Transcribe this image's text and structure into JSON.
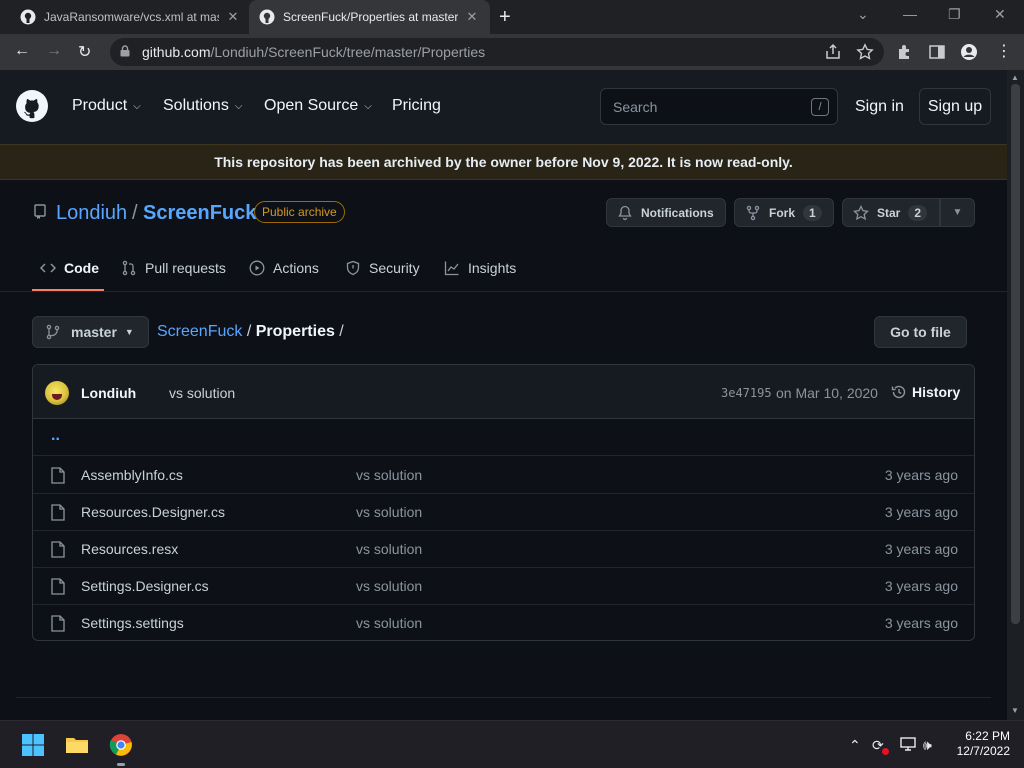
{
  "browser": {
    "tabs": [
      {
        "title": "JavaRansomware/vcs.xml at mast",
        "active": false
      },
      {
        "title": "ScreenFuck/Properties at master",
        "active": true
      }
    ],
    "url_domain": "github.com",
    "url_path": "/Londiuh/ScreenFuck/tree/master/Properties"
  },
  "header": {
    "menu": [
      {
        "label": "Product",
        "dropdown": true
      },
      {
        "label": "Solutions",
        "dropdown": true
      },
      {
        "label": "Open Source",
        "dropdown": true
      },
      {
        "label": "Pricing",
        "dropdown": false
      }
    ],
    "search_placeholder": "Search",
    "search_key": "/",
    "sign_in": "Sign in",
    "sign_up": "Sign up"
  },
  "banner": "This repository has been archived by the owner before Nov 9, 2022. It is now read-only.",
  "repo": {
    "owner": "Londiuh",
    "separator": "/",
    "name": "ScreenFuck",
    "badge": "Public archive",
    "notifications": "Notifications",
    "fork_label": "Fork",
    "fork_count": "1",
    "star_label": "Star",
    "star_count": "2",
    "tabs": [
      "Code",
      "Pull requests",
      "Actions",
      "Security",
      "Insights"
    ]
  },
  "path": {
    "branch": "master",
    "root": "ScreenFuck",
    "sep1": " / ",
    "current": "Properties",
    "sep2": " /",
    "goto_file": "Go to file"
  },
  "commit": {
    "author": "Londiuh",
    "message": "vs solution",
    "sha": "3e47195",
    "date": "on Mar 10, 2020",
    "history": "History"
  },
  "files": {
    "up": "..",
    "rows": [
      {
        "name": "AssemblyInfo.cs",
        "message": "vs solution",
        "age": "3 years ago"
      },
      {
        "name": "Resources.Designer.cs",
        "message": "vs solution",
        "age": "3 years ago"
      },
      {
        "name": "Resources.resx",
        "message": "vs solution",
        "age": "3 years ago"
      },
      {
        "name": "Settings.Designer.cs",
        "message": "vs solution",
        "age": "3 years ago"
      },
      {
        "name": "Settings.settings",
        "message": "vs solution",
        "age": "3 years ago"
      }
    ]
  },
  "taskbar": {
    "time": "6:22 PM",
    "date": "12/7/2022"
  }
}
